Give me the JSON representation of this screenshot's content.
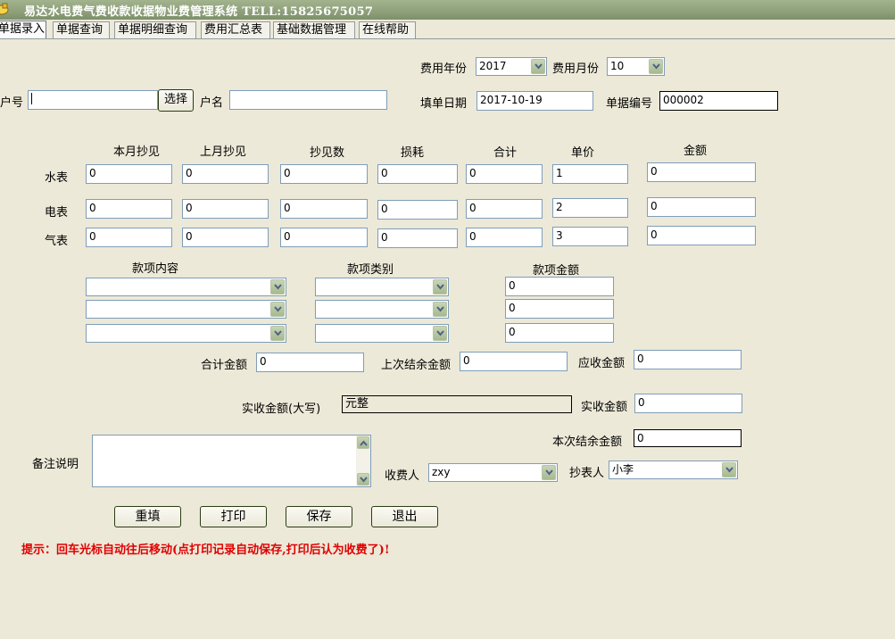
{
  "window": {
    "title": "易达水电费气费收款收据物业费管理系统  TELL:15825675057"
  },
  "tabs": [
    {
      "label": "单据录入",
      "active": true
    },
    {
      "label": "单据查询"
    },
    {
      "label": "单据明细查询"
    },
    {
      "label": "费用汇总表"
    },
    {
      "label": "基础数据管理"
    },
    {
      "label": "在线帮助"
    }
  ],
  "header": {
    "year_label": "费用年份",
    "year_value": "2017",
    "month_label": "费用月份",
    "month_value": "10",
    "account_label": "户号",
    "account_value": "",
    "select_button": "选择",
    "name_label": "户名",
    "name_value": "",
    "date_label": "填单日期",
    "date_value": "2017-10-19",
    "docno_label": "单据编号",
    "docno_value": "000002"
  },
  "meters": {
    "columns": [
      "本月抄见",
      "上月抄见",
      "抄见数",
      "损耗",
      "合计",
      "单价",
      "金额"
    ],
    "rows": [
      {
        "label": "水表",
        "values": [
          "0",
          "0",
          "0",
          "0",
          "0",
          "1",
          "0"
        ]
      },
      {
        "label": "电表",
        "values": [
          "0",
          "0",
          "0",
          "0",
          "0",
          "2",
          "0"
        ]
      },
      {
        "label": "气表",
        "values": [
          "0",
          "0",
          "0",
          "0",
          "0",
          "3",
          "0"
        ]
      }
    ]
  },
  "items": {
    "content_label": "款项内容",
    "type_label": "款项类别",
    "amount_label": "款项金额",
    "rows": [
      {
        "content": "",
        "type": "",
        "amount": "0"
      },
      {
        "content": "",
        "type": "",
        "amount": "0"
      },
      {
        "content": "",
        "type": "",
        "amount": "0"
      }
    ]
  },
  "totals": {
    "total_label": "合计金额",
    "total_value": "0",
    "last_balance_label": "上次结余金额",
    "last_balance_value": "0",
    "receivable_label": "应收金额",
    "receivable_value": "0",
    "paid_upper_label": "实收金额(大写)",
    "paid_upper_value": "元整",
    "paid_label": "实收金额",
    "paid_value": "0",
    "balance_label": "本次结余金额",
    "balance_value": "0"
  },
  "remarks": {
    "label": "备注说明",
    "value": ""
  },
  "people": {
    "collector_label": "收费人",
    "collector_value": "zxy",
    "reader_label": "抄表人",
    "reader_value": "小李"
  },
  "buttons": {
    "reset": "重填",
    "print": "打印",
    "save": "保存",
    "exit": "退出"
  },
  "hint": "提示：回车光标自动往后移动(点打印记录自动保存,打印后认为收费了)!",
  "colors": {
    "background": "#ece9d8",
    "titlebar": "#8ea07a",
    "hint": "#e00000",
    "field_border": "#7f9db9"
  }
}
